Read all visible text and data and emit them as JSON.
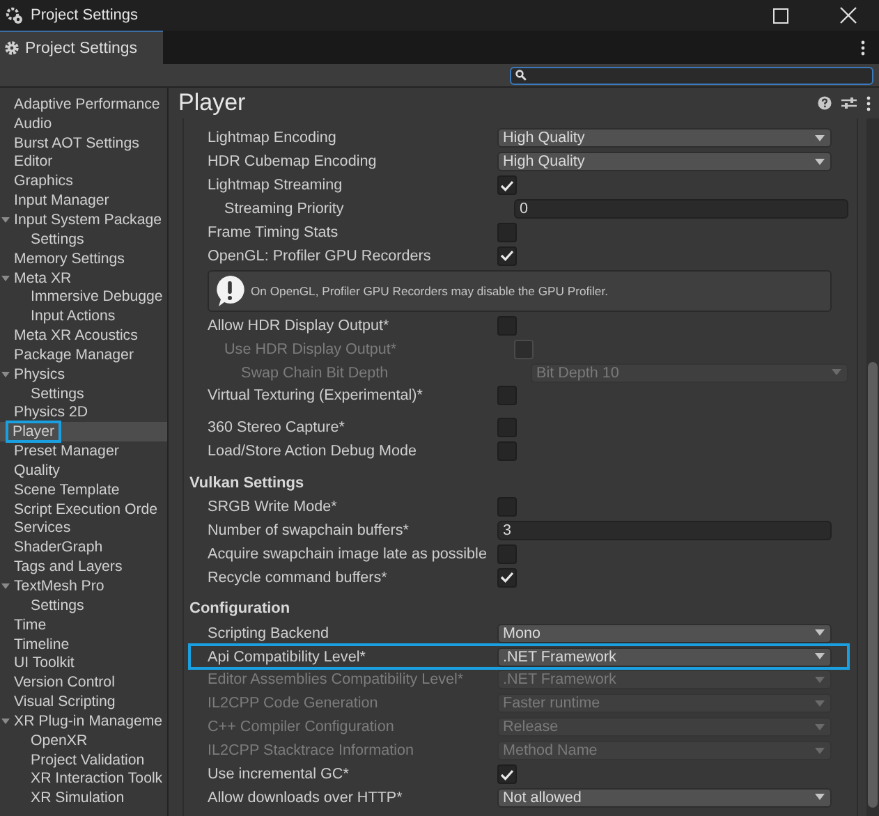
{
  "window": {
    "title": "Project Settings"
  },
  "tab": {
    "label": "Project Settings",
    "selected": true
  },
  "sidebar": {
    "items": [
      {
        "label": "Adaptive Performance",
        "selected": false
      },
      {
        "label": "Audio",
        "selected": false
      },
      {
        "label": "Burst AOT Settings",
        "selected": false
      },
      {
        "label": "Editor",
        "selected": false
      },
      {
        "label": "Graphics",
        "selected": false
      },
      {
        "label": "Input Manager",
        "selected": false
      },
      {
        "label": "Input System Package",
        "selected": false,
        "expanded": true,
        "children": [
          {
            "label": "Settings",
            "selected": false
          }
        ]
      },
      {
        "label": "Memory Settings",
        "selected": false
      },
      {
        "label": "Meta XR",
        "selected": false,
        "expanded": true,
        "children": [
          {
            "label": "Immersive Debugge",
            "selected": false
          },
          {
            "label": "Input Actions",
            "selected": false
          }
        ]
      },
      {
        "label": "Meta XR Acoustics",
        "selected": false
      },
      {
        "label": "Package Manager",
        "selected": false
      },
      {
        "label": "Physics",
        "selected": false,
        "expanded": true,
        "children": [
          {
            "label": "Settings",
            "selected": false
          }
        ]
      },
      {
        "label": "Physics 2D",
        "selected": false
      },
      {
        "label": "Player",
        "selected": true,
        "highlighted": true
      },
      {
        "label": "Preset Manager",
        "selected": false
      },
      {
        "label": "Quality",
        "selected": false
      },
      {
        "label": "Scene Template",
        "selected": false
      },
      {
        "label": "Script Execution Orde",
        "selected": false
      },
      {
        "label": "Services",
        "selected": false
      },
      {
        "label": "ShaderGraph",
        "selected": false
      },
      {
        "label": "Tags and Layers",
        "selected": false
      },
      {
        "label": "TextMesh Pro",
        "selected": false,
        "expanded": true,
        "children": [
          {
            "label": "Settings",
            "selected": false
          }
        ]
      },
      {
        "label": "Time",
        "selected": false
      },
      {
        "label": "Timeline",
        "selected": false
      },
      {
        "label": "UI Toolkit",
        "selected": false
      },
      {
        "label": "Version Control",
        "selected": false
      },
      {
        "label": "Visual Scripting",
        "selected": false
      },
      {
        "label": "XR Plug-in Manageme",
        "selected": false,
        "expanded": true,
        "children": [
          {
            "label": "OpenXR",
            "selected": false
          },
          {
            "label": "Project Validation",
            "selected": false
          },
          {
            "label": "XR Interaction Toolk",
            "selected": false
          },
          {
            "label": "XR Simulation",
            "selected": false
          }
        ]
      }
    ]
  },
  "panel": {
    "title": "Player",
    "sections": [
      {
        "rows": [
          {
            "kind": "dropdown",
            "label": "Lightmap Encoding",
            "value": "High Quality",
            "disabled": false
          },
          {
            "kind": "dropdown",
            "label": "HDR Cubemap Encoding",
            "value": "High Quality",
            "disabled": false
          },
          {
            "kind": "checkbox",
            "label": "Lightmap Streaming",
            "checked": true,
            "disabled": false,
            "children": [
              {
                "kind": "number",
                "label": "Streaming Priority",
                "value": "0"
              }
            ]
          },
          {
            "kind": "checkbox",
            "label": "Frame Timing Stats",
            "checked": false,
            "disabled": false
          },
          {
            "kind": "checkbox",
            "label": "OpenGL: Profiler GPU Recorders",
            "checked": true,
            "disabled": false
          },
          {
            "kind": "helpbox",
            "text": "On OpenGL, Profiler GPU Recorders may disable the GPU Profiler."
          },
          {
            "kind": "checkbox",
            "label": "Allow HDR Display Output*",
            "checked": false,
            "disabled": false,
            "children": [
              {
                "kind": "checkbox",
                "label": "Use HDR Display Output*",
                "checked": false,
                "disabled": true,
                "children": [
                  {
                    "kind": "dropdown",
                    "label": "Swap Chain Bit Depth",
                    "value": "Bit Depth 10",
                    "disabled": true
                  }
                ]
              }
            ]
          },
          {
            "kind": "checkbox",
            "label": "Virtual Texturing (Experimental)*",
            "checked": false,
            "disabled": false
          }
        ]
      },
      {
        "rows": [
          {
            "kind": "checkbox",
            "label": "360 Stereo Capture*",
            "checked": false,
            "disabled": false
          },
          {
            "kind": "checkbox",
            "label": "Load/Store Action Debug Mode",
            "checked": false,
            "disabled": false
          }
        ]
      },
      {
        "title": "Vulkan Settings",
        "rows": [
          {
            "kind": "checkbox",
            "label": "SRGB Write Mode*",
            "checked": false,
            "disabled": false
          },
          {
            "kind": "number",
            "label": "Number of swapchain buffers*",
            "value": "3"
          },
          {
            "kind": "checkbox",
            "label": "Acquire swapchain image late as possible",
            "checked": false,
            "disabled": false
          },
          {
            "kind": "checkbox",
            "label": "Recycle command buffers*",
            "checked": true,
            "disabled": false
          }
        ]
      },
      {
        "title": "Configuration",
        "rows": [
          {
            "kind": "dropdown",
            "label": "Scripting Backend",
            "value": "Mono",
            "disabled": false
          },
          {
            "kind": "dropdown",
            "label": "Api Compatibility Level*",
            "value": ".NET Framework",
            "disabled": false,
            "highlighted": true
          },
          {
            "kind": "dropdown",
            "label": "Editor Assemblies Compatibility Level*",
            "value": ".NET Framework",
            "disabled": true
          },
          {
            "kind": "dropdown",
            "label": "IL2CPP Code Generation",
            "value": "Faster runtime",
            "disabled": true
          },
          {
            "kind": "dropdown",
            "label": "C++ Compiler Configuration",
            "value": "Release",
            "disabled": true
          },
          {
            "kind": "dropdown",
            "label": "IL2CPP Stacktrace Information",
            "value": "Method Name",
            "disabled": true
          },
          {
            "kind": "checkbox",
            "label": "Use incremental GC*",
            "checked": true,
            "disabled": false
          },
          {
            "kind": "dropdown",
            "label": "Allow downloads over HTTP*",
            "value": "Not allowed",
            "disabled": false
          }
        ]
      }
    ]
  }
}
